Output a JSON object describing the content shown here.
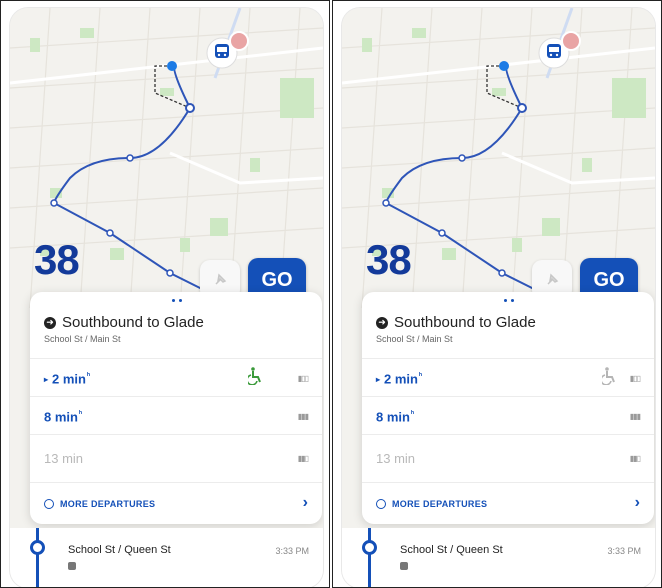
{
  "screens": [
    {
      "route_number": "38",
      "go_label": "GO",
      "direction_title": "Southbound to Glade",
      "stop_subtitle": "School St / Main St",
      "departures": [
        {
          "time": "2 min",
          "realtime": true,
          "highlighted": true,
          "wheelchair_color": "#3a9a3a"
        },
        {
          "time": "8 min",
          "realtime": true,
          "highlighted": false
        },
        {
          "time": "13 min",
          "realtime": false,
          "highlighted": false
        }
      ],
      "more_departures_label": "MORE DEPARTURES",
      "next_stop": {
        "name": "School St / Queen St",
        "time": "3:33 PM"
      }
    },
    {
      "route_number": "38",
      "go_label": "GO",
      "direction_title": "Southbound to Glade",
      "stop_subtitle": "School St / Main St",
      "departures": [
        {
          "time": "2 min",
          "realtime": true,
          "highlighted": true,
          "wheelchair_color": "#b5b5b5"
        },
        {
          "time": "8 min",
          "realtime": true,
          "highlighted": false
        },
        {
          "time": "13 min",
          "realtime": false,
          "highlighted": false
        }
      ],
      "more_departures_label": "MORE DEPARTURES",
      "next_stop": {
        "name": "School St / Queen St",
        "time": "3:33 PM"
      }
    }
  ],
  "colors": {
    "accent": "#1450b8",
    "route_line": "#2e55b8",
    "park": "#cde8c3",
    "map_bg": "#f3f2ee"
  },
  "icons": [
    "bus-icon",
    "pin-icon",
    "wheelchair-icon",
    "info-icon",
    "chevron-right-icon",
    "direction-arrow-icon"
  ]
}
